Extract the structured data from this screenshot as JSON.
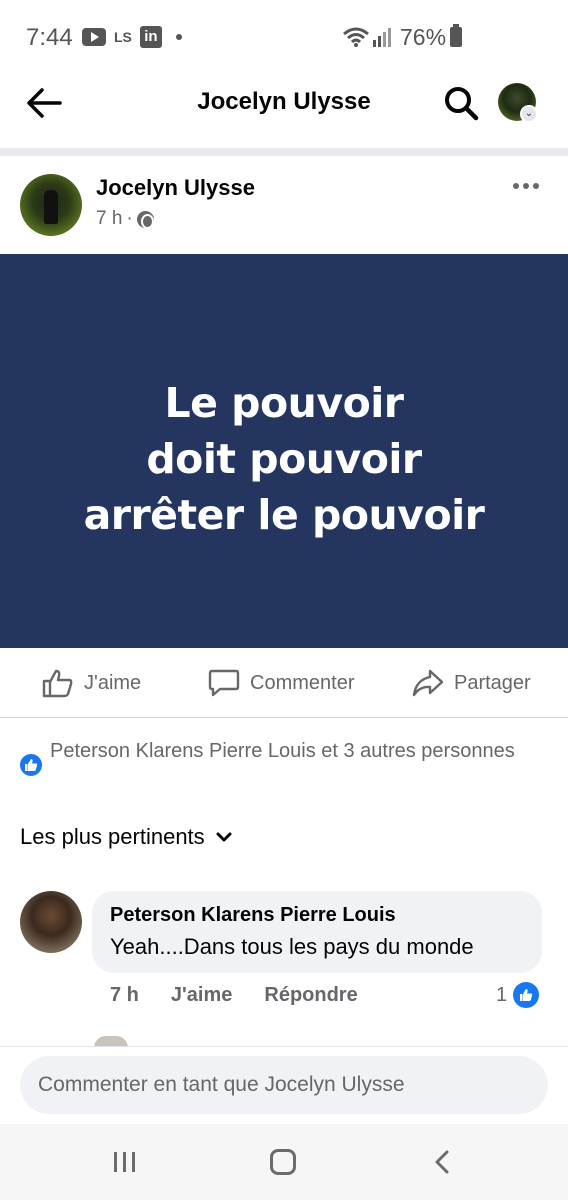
{
  "status_bar": {
    "time": "7:44",
    "ls_label": "LS",
    "linkedin_label": "in",
    "battery": "76%"
  },
  "header": {
    "title": "Jocelyn Ulysse"
  },
  "post": {
    "author": "Jocelyn Ulysse",
    "time": "7 h",
    "separator": "·",
    "image_text": "Le pouvoir\ndoit pouvoir\narrêter le pouvoir"
  },
  "actions": {
    "like": "J'aime",
    "comment": "Commenter",
    "share": "Partager"
  },
  "reactions": {
    "summary": "Peterson Klarens Pierre Louis et 3 autres personnes"
  },
  "sort": {
    "label": "Les plus pertinents"
  },
  "comment": {
    "author": "Peterson Klarens Pierre Louis",
    "text": "Yeah....Dans tous les pays du monde",
    "time": "7 h",
    "like_label": "J'aime",
    "reply_label": "Répondre",
    "like_count": "1"
  },
  "composer": {
    "placeholder": "Commenter en tant que Jocelyn Ulysse"
  },
  "colors": {
    "post_bg": "#243660",
    "accent": "#1877f2",
    "muted": "#65676b"
  }
}
